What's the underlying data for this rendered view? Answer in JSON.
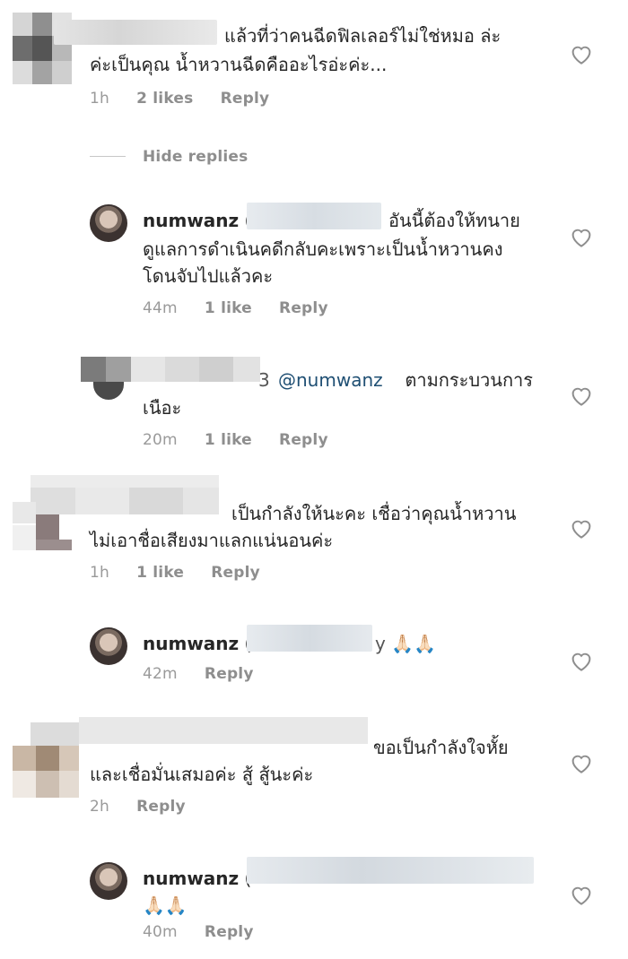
{
  "comments": [
    {
      "text": "แล้วที่ว่าคนฉีดฟิลเลอร์ไม่ใช่หมอ ล่ะ",
      "text2": "ค่ะเป็นคุณ น้ำหวานฉีดคืออะไรอ่ะค่ะ...",
      "time": "1h",
      "likes": "2 likes",
      "reply": "Reply"
    },
    {
      "username": "numwanz",
      "text": "อันนี้ต้องให้ทนาย",
      "text2": "ดูแลการดำเนินคดีกลับคะเพราะเป็นน้ำหวานคง",
      "text3": "โดนจับไปแล้วคะ",
      "time": "44m",
      "likes": "1 like",
      "reply": "Reply"
    },
    {
      "suffix": "3",
      "mention": "@numwanz",
      "text": "ตามกระบวนการ",
      "text2": "เนือะ",
      "time": "20m",
      "likes": "1 like",
      "reply": "Reply"
    },
    {
      "text": "เป็นกำลังให้นะคะ เชื่อว่าคุณน้ำหวาน",
      "text2": "ไม่เอาชื่อเสียงมาแลกแน่นอนค่ะ",
      "time": "1h",
      "likes": "1 like",
      "reply": "Reply"
    },
    {
      "username": "numwanz",
      "suffix": "y",
      "emoji": "🙏🏻🙏🏻",
      "time": "42m",
      "reply": "Reply"
    },
    {
      "text": "ขอเป็นกำลังใจหั้ย",
      "text2": "และเชื่อมั่นเสมอค่ะ สู้ สู้นะค่ะ",
      "time": "2h",
      "reply": "Reply"
    },
    {
      "username": "numwanz",
      "emoji": "🙏🏻🙏🏻",
      "time": "40m",
      "reply": "Reply"
    }
  ],
  "hide_replies": "Hide replies",
  "icons": {
    "like": "heart-outline-icon"
  },
  "colors": {
    "meta": "#8e8e8e",
    "mention": "#1f4f73",
    "text": "#262626"
  }
}
